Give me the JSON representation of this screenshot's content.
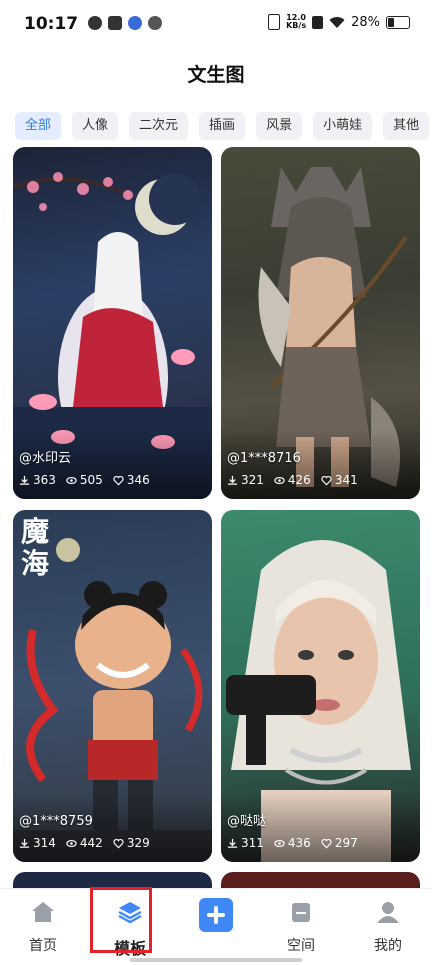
{
  "status_bar": {
    "time": "10:17",
    "net_speed": "12.0",
    "net_unit": "KB/s",
    "battery": "28%"
  },
  "header": {
    "title": "文生图"
  },
  "tabs": [
    {
      "label": "全部",
      "active": true
    },
    {
      "label": "人像"
    },
    {
      "label": "二次元"
    },
    {
      "label": "插画"
    },
    {
      "label": "风景"
    },
    {
      "label": "小萌娃"
    },
    {
      "label": "其他"
    }
  ],
  "cards": [
    {
      "author": "@水印云",
      "downloads": "363",
      "views": "505",
      "likes": "346"
    },
    {
      "author": "@1***8716",
      "downloads": "321",
      "views": "426",
      "likes": "341"
    },
    {
      "author": "@1***8759",
      "downloads": "314",
      "views": "442",
      "likes": "329"
    },
    {
      "author": "@哒哒",
      "downloads": "311",
      "views": "436",
      "likes": "297"
    }
  ],
  "card3_art_text": {
    "title": "魔海"
  },
  "nav": {
    "home": "首页",
    "templates": "模板",
    "space": "空间",
    "mine": "我的"
  },
  "colors": {
    "accent": "#2f7cf6",
    "tab_active_bg": "#e3edff",
    "highlight": "#e4202a",
    "plus_button": "#3f88f5"
  }
}
